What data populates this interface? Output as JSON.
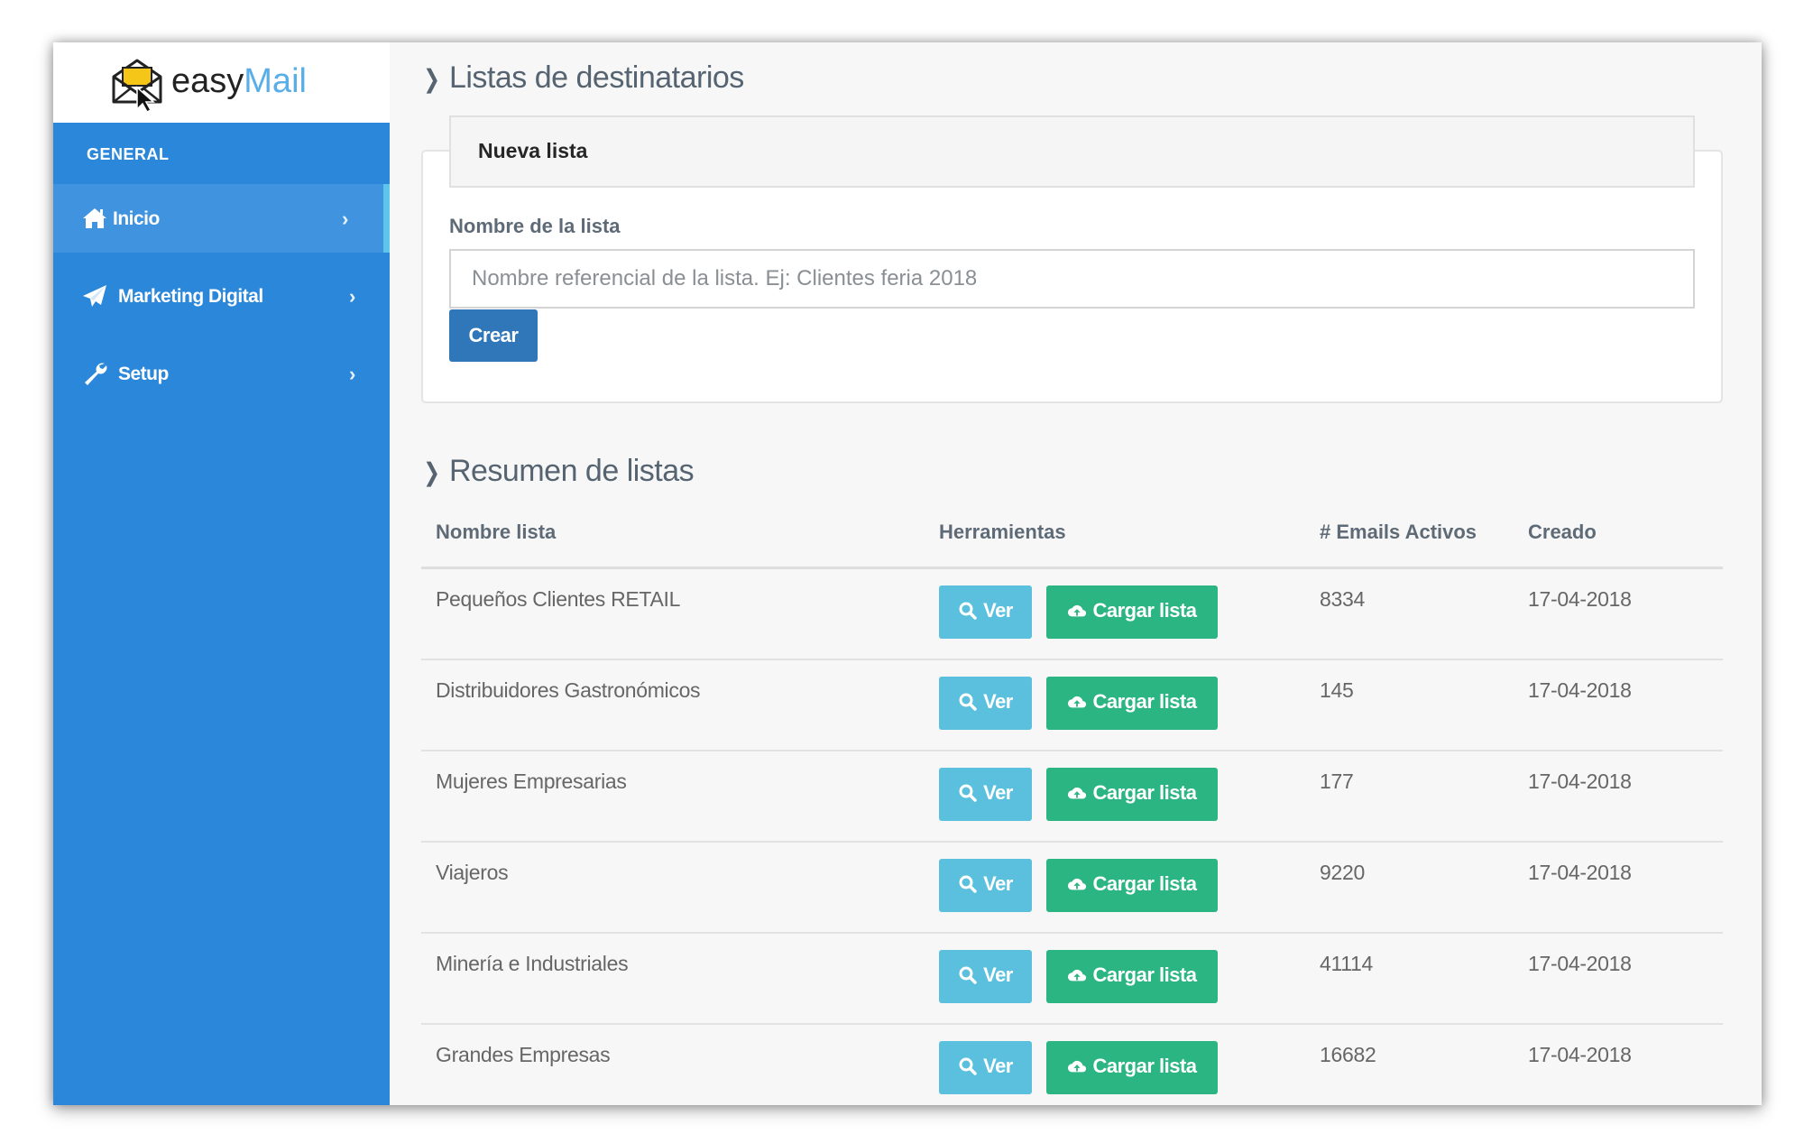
{
  "brand": {
    "name_part1": "easy",
    "name_part2": "Mail"
  },
  "sidebar": {
    "section_label": "GENERAL",
    "items": [
      {
        "label": "Inicio",
        "icon": "home-icon",
        "active": true
      },
      {
        "label": "Marketing Digital",
        "icon": "paper-plane-icon",
        "active": false
      },
      {
        "label": "Setup",
        "icon": "wrench-icon",
        "active": false
      }
    ]
  },
  "page": {
    "title": "Listas de destinatarios",
    "new_list": {
      "heading": "Nueva lista",
      "field_label": "Nombre de la lista",
      "placeholder": "Nombre referencial de la lista. Ej: Clientes feria 2018",
      "value": "",
      "create_button": "Crear"
    },
    "summary": {
      "title": "Resumen de listas",
      "columns": [
        "Nombre lista",
        "Herramientas",
        "# Emails Activos",
        "Creado"
      ],
      "view_button": "Ver",
      "upload_button": "Cargar lista",
      "rows": [
        {
          "name": "Pequeños Clientes RETAIL",
          "emails": "8334",
          "created": "17-04-2018"
        },
        {
          "name": "Distribuidores Gastronómicos",
          "emails": "145",
          "created": "17-04-2018"
        },
        {
          "name": "Mujeres Empresarias",
          "emails": "177",
          "created": "17-04-2018"
        },
        {
          "name": "Viajeros",
          "emails": "9220",
          "created": "17-04-2018"
        },
        {
          "name": "Minería e Industriales",
          "emails": "41114",
          "created": "17-04-2018"
        },
        {
          "name": "Grandes Empresas",
          "emails": "16682",
          "created": "17-04-2018"
        }
      ]
    }
  },
  "colors": {
    "sidebar": "#2b87d9",
    "sidebar_active": "#4094df",
    "btn_primary": "#2f77b8",
    "btn_info": "#5bc0de",
    "btn_success": "#2bb582"
  }
}
